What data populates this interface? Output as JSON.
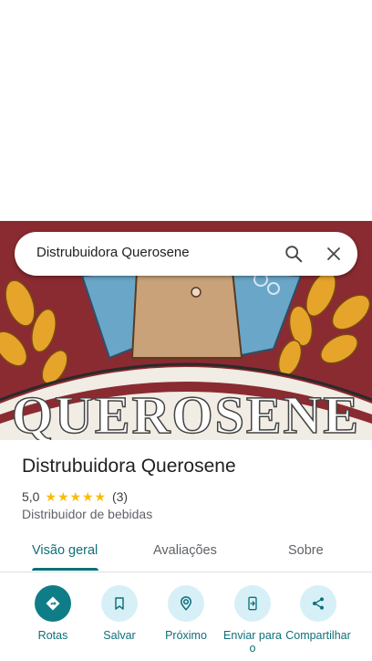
{
  "search": {
    "query": "Distrubuidora Querosene"
  },
  "place": {
    "name": "Distrubuidora Querosene",
    "rating_value": "5,0",
    "rating_stars": 5,
    "review_count": "(3)",
    "category": "Distribuidor de bebidas",
    "photo_sign_text": "QUEROSENE"
  },
  "tabs": [
    {
      "label": "Visão geral",
      "active": true
    },
    {
      "label": "Avaliações",
      "active": false
    },
    {
      "label": "Sobre",
      "active": false
    }
  ],
  "actions": [
    {
      "label": "Rotas",
      "icon": "directions-icon"
    },
    {
      "label": "Salvar",
      "icon": "bookmark-icon"
    },
    {
      "label": "Próximo",
      "icon": "nearby-icon"
    },
    {
      "label": "Enviar para o",
      "icon": "send-to-phone-icon"
    },
    {
      "label": "Compartilhar",
      "icon": "share-icon"
    }
  ],
  "colors": {
    "accent": "#0e6f78",
    "accent_button": "#0f7d87",
    "button_bg": "#d7f0f7",
    "star": "#fbbc04",
    "photo_background": "#8a2b31"
  }
}
